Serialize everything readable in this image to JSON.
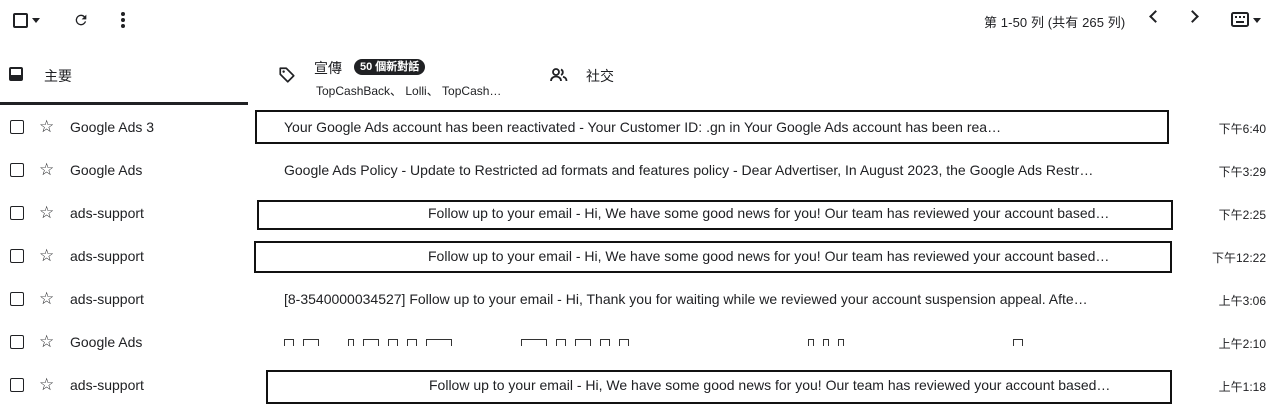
{
  "toolbar": {
    "select_icon": "checkbox-icon",
    "refresh_icon": "refresh-icon",
    "more_icon": "more-vert-icon",
    "pager_text": "第 1-50 列 (共有 265 列)",
    "input_tool_icon": "keyboard-icon"
  },
  "tabs": [
    {
      "label": "主要",
      "icon": "inbox-icon"
    },
    {
      "label": "宣傳",
      "icon": "tag-icon",
      "badge": "50 個新對話",
      "senders": "TopCashBack、 Lolli、 TopCash…"
    },
    {
      "label": "社交",
      "icon": "people-icon"
    }
  ],
  "rows": [
    {
      "sender": "Google Ads 3",
      "subject": "Your Google Ads account has been reactivated - Your Customer ID:                          .gn in Your Google Ads account has been rea…",
      "time": "下午6:40"
    },
    {
      "sender": "Google Ads",
      "subject": "Google Ads Policy - Update to Restricted ad formats and features policy - Dear Advertiser, In August 2023, the Google Ads Restr…",
      "time": "下午3:29"
    },
    {
      "sender": "ads-support",
      "subject": "Follow up to your email - Hi, We have some good news for you! Our team has reviewed your account based…",
      "time": "下午2:25"
    },
    {
      "sender": "ads-support",
      "subject": "Follow up to your email - Hi, We have some good news for you! Our team has reviewed your account based…",
      "time": "下午12:22"
    },
    {
      "sender": "ads-support",
      "subject": "[8-3540000034527] Follow up to your email - Hi, Thank you for waiting while we reviewed your account suspension appeal. Afte…",
      "time": "上午3:06"
    },
    {
      "sender": "Google Ads",
      "subject": "",
      "time": "上午2:10"
    },
    {
      "sender": "ads-support",
      "subject": "Follow up to your email - Hi, We have some good news for you! Our team has reviewed your account based…",
      "time": "上午1:18"
    }
  ]
}
